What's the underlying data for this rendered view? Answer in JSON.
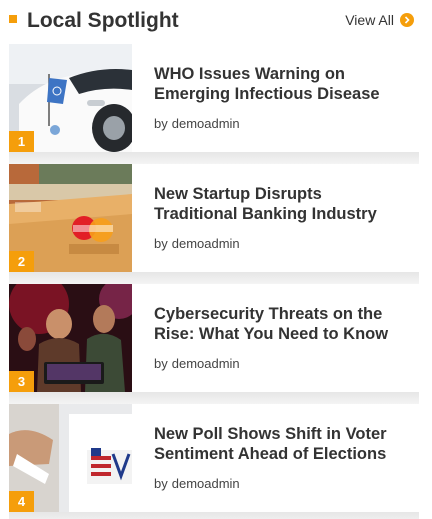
{
  "header": {
    "title": "Local Spotlight",
    "view_all_label": "View All",
    "view_all_icon": "chevron-right-circle-icon",
    "accent_color": "#f59e0b"
  },
  "articles": [
    {
      "rank": "1",
      "title": "WHO Issues Warning on Emerging Infectious Disease",
      "by": "by",
      "author": "demoadmin",
      "image": "un-vehicle-flag-photo"
    },
    {
      "rank": "2",
      "title": "New Startup Disrupts Traditional Banking Industry",
      "by": "by",
      "author": "demoadmin",
      "image": "credit-cards-photo"
    },
    {
      "rank": "3",
      "title": "Cybersecurity Threats on the Rise: What You Need to Know",
      "by": "by",
      "author": "demoadmin",
      "image": "people-at-laptop-neon-photo"
    },
    {
      "rank": "4",
      "title": "New Poll Shows Shift in Voter Sentiment Ahead of Elections",
      "by": "by",
      "author": "demoadmin",
      "image": "voting-ballot-box-photo"
    }
  ]
}
